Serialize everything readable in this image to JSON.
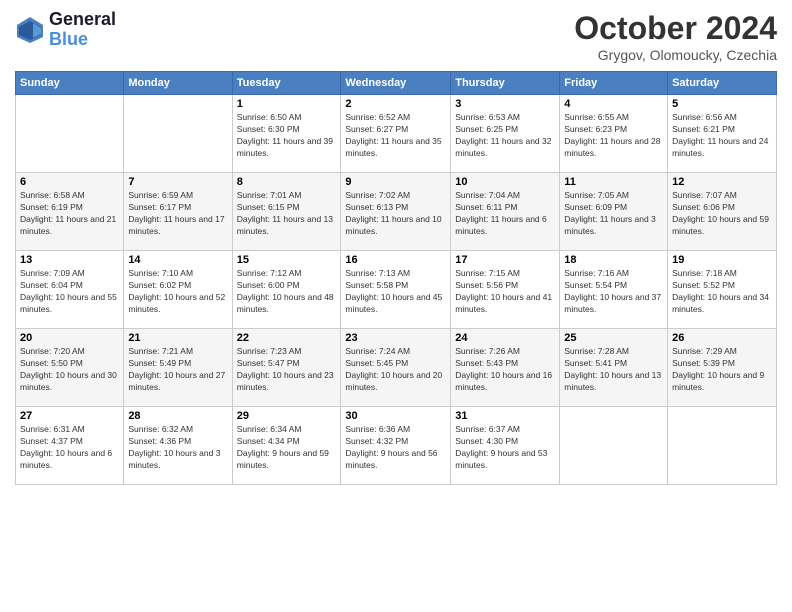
{
  "header": {
    "logo_line1": "General",
    "logo_line2": "Blue",
    "month_title": "October 2024",
    "location": "Grygov, Olomoucky, Czechia"
  },
  "weekdays": [
    "Sunday",
    "Monday",
    "Tuesday",
    "Wednesday",
    "Thursday",
    "Friday",
    "Saturday"
  ],
  "weeks": [
    [
      {
        "day": "",
        "info": ""
      },
      {
        "day": "",
        "info": ""
      },
      {
        "day": "1",
        "info": "Sunrise: 6:50 AM\nSunset: 6:30 PM\nDaylight: 11 hours and 39 minutes."
      },
      {
        "day": "2",
        "info": "Sunrise: 6:52 AM\nSunset: 6:27 PM\nDaylight: 11 hours and 35 minutes."
      },
      {
        "day": "3",
        "info": "Sunrise: 6:53 AM\nSunset: 6:25 PM\nDaylight: 11 hours and 32 minutes."
      },
      {
        "day": "4",
        "info": "Sunrise: 6:55 AM\nSunset: 6:23 PM\nDaylight: 11 hours and 28 minutes."
      },
      {
        "day": "5",
        "info": "Sunrise: 6:56 AM\nSunset: 6:21 PM\nDaylight: 11 hours and 24 minutes."
      }
    ],
    [
      {
        "day": "6",
        "info": "Sunrise: 6:58 AM\nSunset: 6:19 PM\nDaylight: 11 hours and 21 minutes."
      },
      {
        "day": "7",
        "info": "Sunrise: 6:59 AM\nSunset: 6:17 PM\nDaylight: 11 hours and 17 minutes."
      },
      {
        "day": "8",
        "info": "Sunrise: 7:01 AM\nSunset: 6:15 PM\nDaylight: 11 hours and 13 minutes."
      },
      {
        "day": "9",
        "info": "Sunrise: 7:02 AM\nSunset: 6:13 PM\nDaylight: 11 hours and 10 minutes."
      },
      {
        "day": "10",
        "info": "Sunrise: 7:04 AM\nSunset: 6:11 PM\nDaylight: 11 hours and 6 minutes."
      },
      {
        "day": "11",
        "info": "Sunrise: 7:05 AM\nSunset: 6:09 PM\nDaylight: 11 hours and 3 minutes."
      },
      {
        "day": "12",
        "info": "Sunrise: 7:07 AM\nSunset: 6:06 PM\nDaylight: 10 hours and 59 minutes."
      }
    ],
    [
      {
        "day": "13",
        "info": "Sunrise: 7:09 AM\nSunset: 6:04 PM\nDaylight: 10 hours and 55 minutes."
      },
      {
        "day": "14",
        "info": "Sunrise: 7:10 AM\nSunset: 6:02 PM\nDaylight: 10 hours and 52 minutes."
      },
      {
        "day": "15",
        "info": "Sunrise: 7:12 AM\nSunset: 6:00 PM\nDaylight: 10 hours and 48 minutes."
      },
      {
        "day": "16",
        "info": "Sunrise: 7:13 AM\nSunset: 5:58 PM\nDaylight: 10 hours and 45 minutes."
      },
      {
        "day": "17",
        "info": "Sunrise: 7:15 AM\nSunset: 5:56 PM\nDaylight: 10 hours and 41 minutes."
      },
      {
        "day": "18",
        "info": "Sunrise: 7:16 AM\nSunset: 5:54 PM\nDaylight: 10 hours and 37 minutes."
      },
      {
        "day": "19",
        "info": "Sunrise: 7:18 AM\nSunset: 5:52 PM\nDaylight: 10 hours and 34 minutes."
      }
    ],
    [
      {
        "day": "20",
        "info": "Sunrise: 7:20 AM\nSunset: 5:50 PM\nDaylight: 10 hours and 30 minutes."
      },
      {
        "day": "21",
        "info": "Sunrise: 7:21 AM\nSunset: 5:49 PM\nDaylight: 10 hours and 27 minutes."
      },
      {
        "day": "22",
        "info": "Sunrise: 7:23 AM\nSunset: 5:47 PM\nDaylight: 10 hours and 23 minutes."
      },
      {
        "day": "23",
        "info": "Sunrise: 7:24 AM\nSunset: 5:45 PM\nDaylight: 10 hours and 20 minutes."
      },
      {
        "day": "24",
        "info": "Sunrise: 7:26 AM\nSunset: 5:43 PM\nDaylight: 10 hours and 16 minutes."
      },
      {
        "day": "25",
        "info": "Sunrise: 7:28 AM\nSunset: 5:41 PM\nDaylight: 10 hours and 13 minutes."
      },
      {
        "day": "26",
        "info": "Sunrise: 7:29 AM\nSunset: 5:39 PM\nDaylight: 10 hours and 9 minutes."
      }
    ],
    [
      {
        "day": "27",
        "info": "Sunrise: 6:31 AM\nSunset: 4:37 PM\nDaylight: 10 hours and 6 minutes."
      },
      {
        "day": "28",
        "info": "Sunrise: 6:32 AM\nSunset: 4:36 PM\nDaylight: 10 hours and 3 minutes."
      },
      {
        "day": "29",
        "info": "Sunrise: 6:34 AM\nSunset: 4:34 PM\nDaylight: 9 hours and 59 minutes."
      },
      {
        "day": "30",
        "info": "Sunrise: 6:36 AM\nSunset: 4:32 PM\nDaylight: 9 hours and 56 minutes."
      },
      {
        "day": "31",
        "info": "Sunrise: 6:37 AM\nSunset: 4:30 PM\nDaylight: 9 hours and 53 minutes."
      },
      {
        "day": "",
        "info": ""
      },
      {
        "day": "",
        "info": ""
      }
    ]
  ]
}
